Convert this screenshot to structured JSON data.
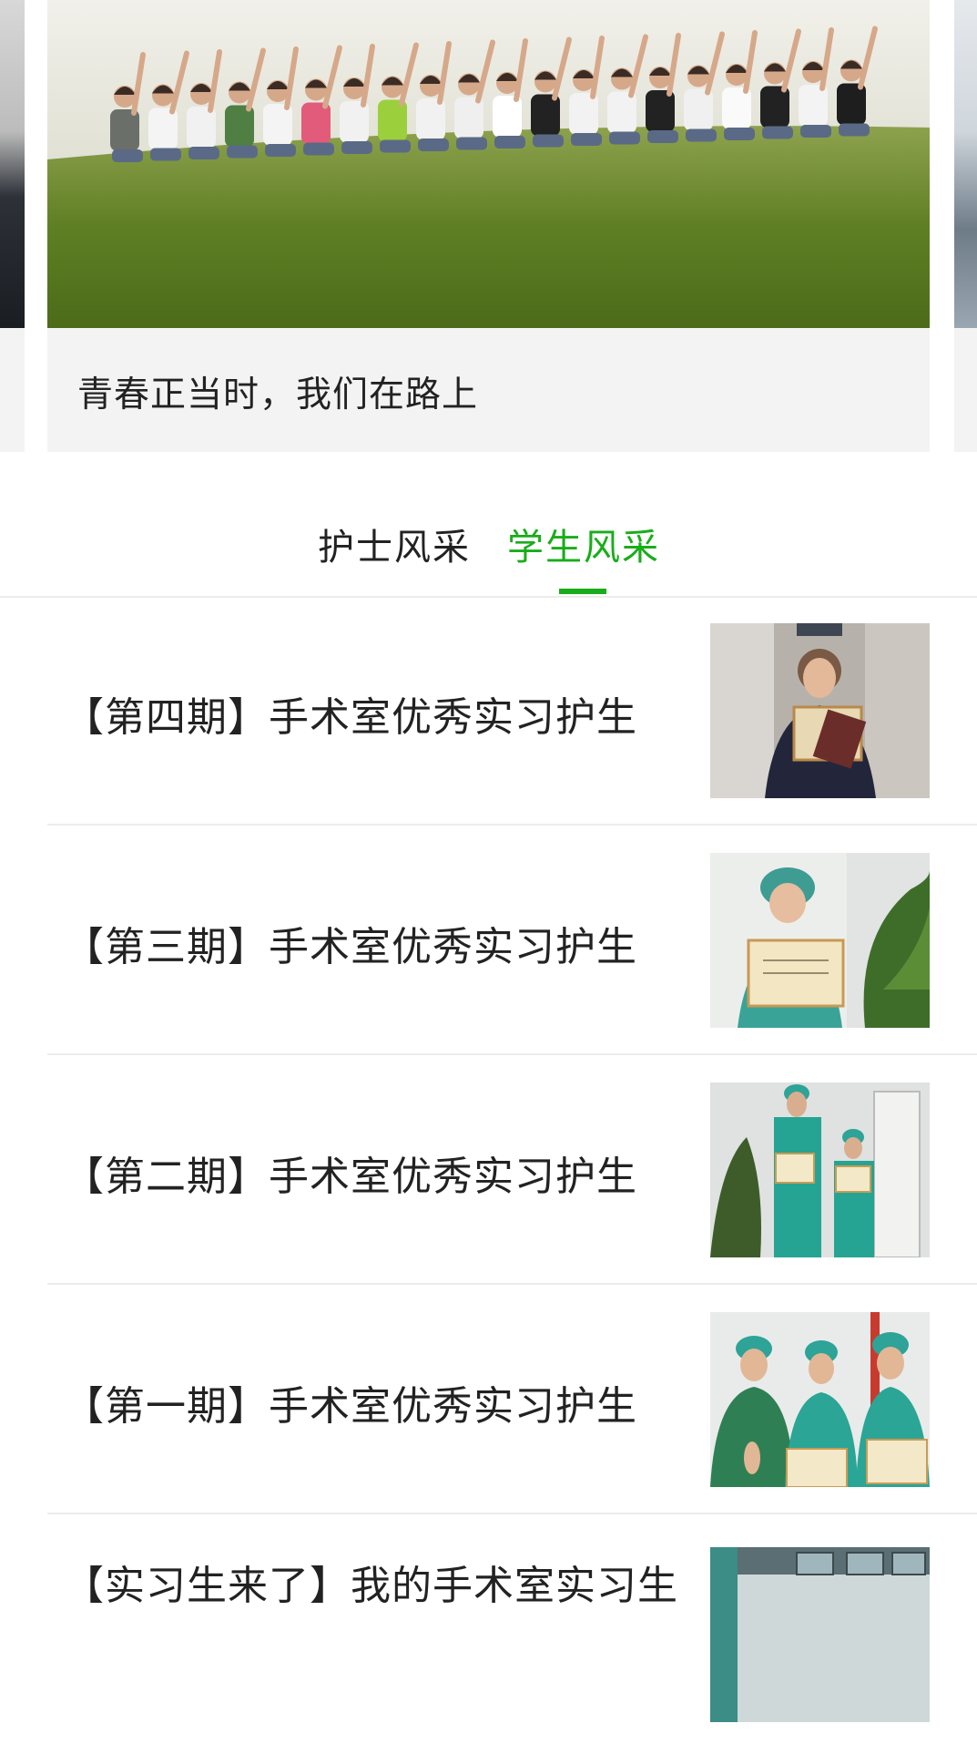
{
  "carousel": {
    "caption": "青春正当时，我们在路上",
    "image_icon": "group-photo-image"
  },
  "tabs": [
    {
      "label": "护士风采",
      "active": false
    },
    {
      "label": "学生风采",
      "active": true
    }
  ],
  "accent_color": "#19ad19",
  "list": [
    {
      "title": "【第四期】手术室优秀实习护生",
      "thumb_icon": "student-certificate-photo"
    },
    {
      "title": "【第三期】手术室优秀实习护生",
      "thumb_icon": "student-certificate-photo"
    },
    {
      "title": "【第二期】手术室优秀实习护生",
      "thumb_icon": "students-certificate-photo"
    },
    {
      "title": "【第一期】手术室优秀实习护生",
      "thumb_icon": "students-certificate-photo"
    },
    {
      "title": "【实习生来了】我的手术室实习生",
      "thumb_icon": "operating-room-photo"
    }
  ]
}
